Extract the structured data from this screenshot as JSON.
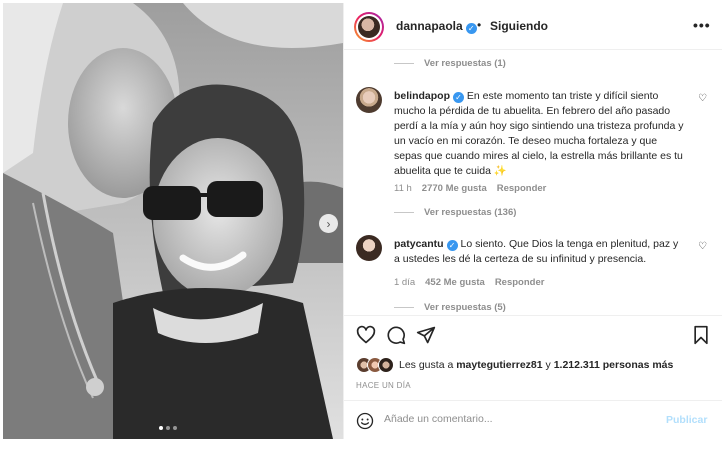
{
  "post": {
    "author": "dannapaola",
    "separator": "•",
    "follow_status": "Siguiendo",
    "more_label": "•••",
    "carousel_dots": 3,
    "active_dot": 1
  },
  "thread": {
    "top_replies": "Ver respuestas (1)",
    "comments": [
      {
        "username": "belindapop",
        "text": "En este momento tan triste y difícil siento mucho la pérdida de tu abuelita. En febrero del año pasado perdí a la mía y aún hoy sigo sintiendo una tristeza profunda y un vacío en mi corazón. Te deseo mucha fortaleza y que sepas que cuando mires al cielo, la estrella más brillante es tu abuelita que te cuida ✨",
        "time": "11 h",
        "likes": "2770 Me gusta",
        "reply": "Responder",
        "view_replies": "Ver respuestas (136)"
      },
      {
        "username": "patycantu",
        "text": "Lo siento. Que Dios la tenga en plenitud, paz y a ustedes les dé la certeza de su infinitud y presencia.",
        "time": "1 día",
        "likes": "452 Me gusta",
        "reply": "Responder",
        "view_replies": "Ver respuestas (5)"
      }
    ]
  },
  "actions": {
    "likes_prefix": "Les gusta a",
    "liked_by": "maytegutierrez81",
    "likes_middle": "y",
    "likes_count": "1.212.311 personas más",
    "posted_ago": "HACE UN DÍA"
  },
  "comment_box": {
    "placeholder": "Añade un comentario...",
    "publish_label": "Publicar"
  },
  "icons": {
    "like": "heart-icon",
    "comment": "comment-icon",
    "share": "paper-plane-icon",
    "save": "bookmark-icon",
    "emoji": "emoji-icon",
    "next": "chevron-right-icon"
  },
  "colors": {
    "verified": "#3897f0",
    "muted": "#8e8e8e",
    "publish_disabled": "#b2dffc",
    "text": "#262626"
  }
}
